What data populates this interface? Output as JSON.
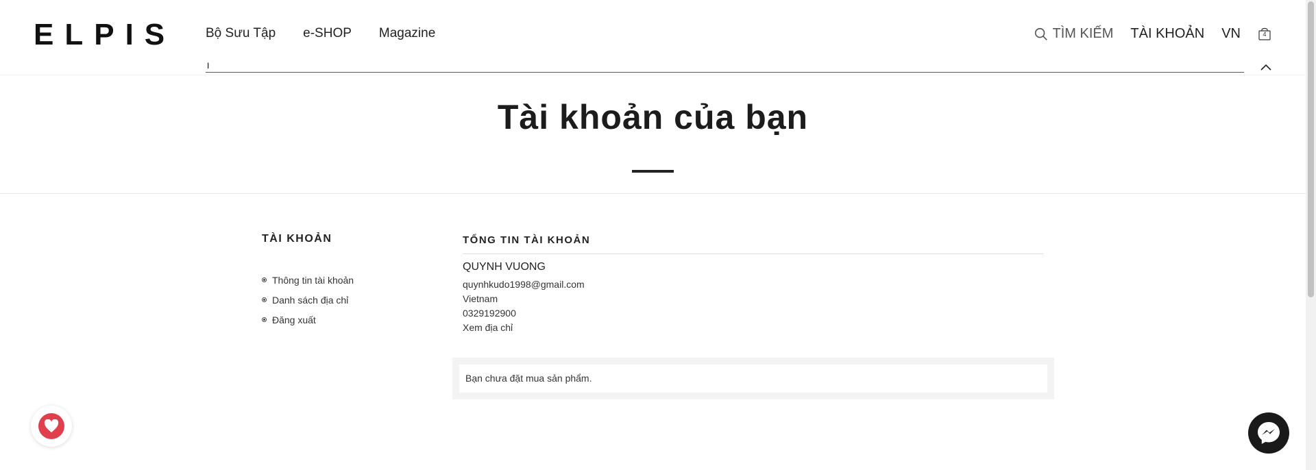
{
  "header": {
    "logo": "ELPIS",
    "nav": [
      "Bộ Sưu Tập",
      "e-SHOP",
      "Magazine"
    ],
    "search_label": "TÌM KIẾM",
    "account_label": "TÀI KHOẢN",
    "language": "VN",
    "cart_count": "4",
    "search_value": "I"
  },
  "page": {
    "title": "Tài khoản của bạn"
  },
  "sidebar": {
    "heading": "TÀI KHOẢN",
    "items": [
      "Thông tin tài khoản",
      "Danh sách địa chỉ",
      "Đăng xuất"
    ]
  },
  "account": {
    "heading": "TỔNG TIN TÀI KHOẢN",
    "name": "QUYNH VUONG",
    "email": "quynhkudo1998@gmail.com",
    "country": "Vietnam",
    "phone": "0329192900",
    "view_address": "Xem địa chỉ"
  },
  "orders": {
    "empty_message": "Bạn chưa đặt mua sản phẩm."
  },
  "colors": {
    "favorite": "#e0404b",
    "messenger": "#1a1a1a"
  }
}
